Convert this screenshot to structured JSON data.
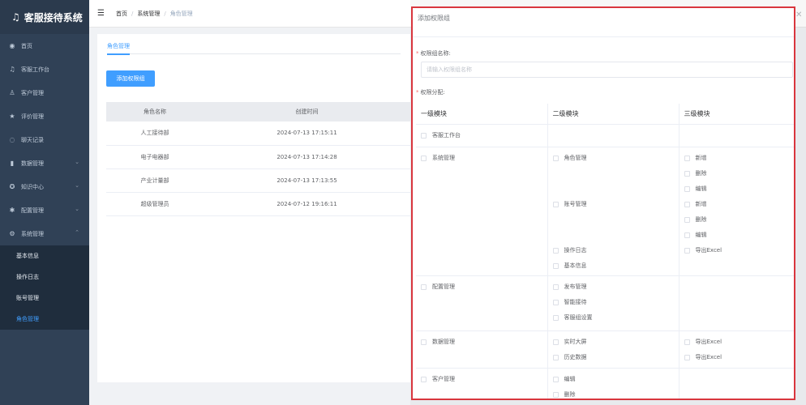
{
  "app": {
    "title": "客服接待系统"
  },
  "sidebar": {
    "items": [
      {
        "label": "首页",
        "icon": "dashboard-icon",
        "glyph": "◉"
      },
      {
        "label": "客服工作台",
        "icon": "headset-icon",
        "glyph": "♫"
      },
      {
        "label": "客户管理",
        "icon": "user-icon",
        "glyph": "♙"
      },
      {
        "label": "评价管理",
        "icon": "star-icon",
        "glyph": "★"
      },
      {
        "label": "聊天记录",
        "icon": "chat-icon",
        "glyph": "◌"
      },
      {
        "label": "数据管理",
        "icon": "bar-chart-icon",
        "glyph": "▮"
      },
      {
        "label": "知识中心",
        "icon": "knowledge-icon",
        "glyph": "✪"
      },
      {
        "label": "配置管理",
        "icon": "gear-icon",
        "glyph": "✱"
      },
      {
        "label": "系统管理",
        "icon": "cog-icon",
        "glyph": "⚙"
      }
    ],
    "submenu": [
      "基本信息",
      "操作日志",
      "账号管理",
      "角色管理"
    ]
  },
  "breadcrumb": [
    "首页",
    "系统管理",
    "角色管理"
  ],
  "card": {
    "tab": "角色管理",
    "add_button": "添加权限组",
    "columns": [
      "角色名称",
      "创建时间"
    ],
    "rows": [
      [
        "人工接待部",
        "2024-07-13 17:15:11"
      ],
      [
        "电子电器部",
        "2024-07-13 17:14:28"
      ],
      [
        "产业计量部",
        "2024-07-13 17:13:55"
      ],
      [
        "超级管理员",
        "2024-07-12 19:16:11"
      ]
    ]
  },
  "drawer": {
    "title": "添加权限组",
    "name_label": "权限组名称:",
    "name_placeholder": "请输入权限组名称",
    "perm_label": "权限分配:",
    "columns": [
      "一级模块",
      "二级模块",
      "三级模块"
    ],
    "modules": [
      {
        "l1": "客服工作台",
        "l2": [],
        "l3": []
      },
      {
        "l1": "系统管理",
        "l2": [
          "角色管理",
          "账号管理",
          "操作日志",
          "基本信息"
        ],
        "l3": [
          "新增",
          "删除",
          "编辑",
          "新增",
          "删除",
          "编辑",
          "导出Excel"
        ]
      },
      {
        "l1": "配置管理",
        "l2": [
          "发布管理",
          "智能接待",
          "客服组设置"
        ],
        "l3": []
      },
      {
        "l1": "数据管理",
        "l2": [
          "实时大屏",
          "历史数据"
        ],
        "l3": [
          "导出Excel",
          "导出Excel"
        ]
      },
      {
        "l1": "客户管理",
        "l2": [
          "编辑",
          "删除"
        ],
        "l3": []
      }
    ]
  },
  "colors": {
    "sidebar_bg": "#304156",
    "accent": "#409eff",
    "highlight_border": "#d9363e"
  }
}
